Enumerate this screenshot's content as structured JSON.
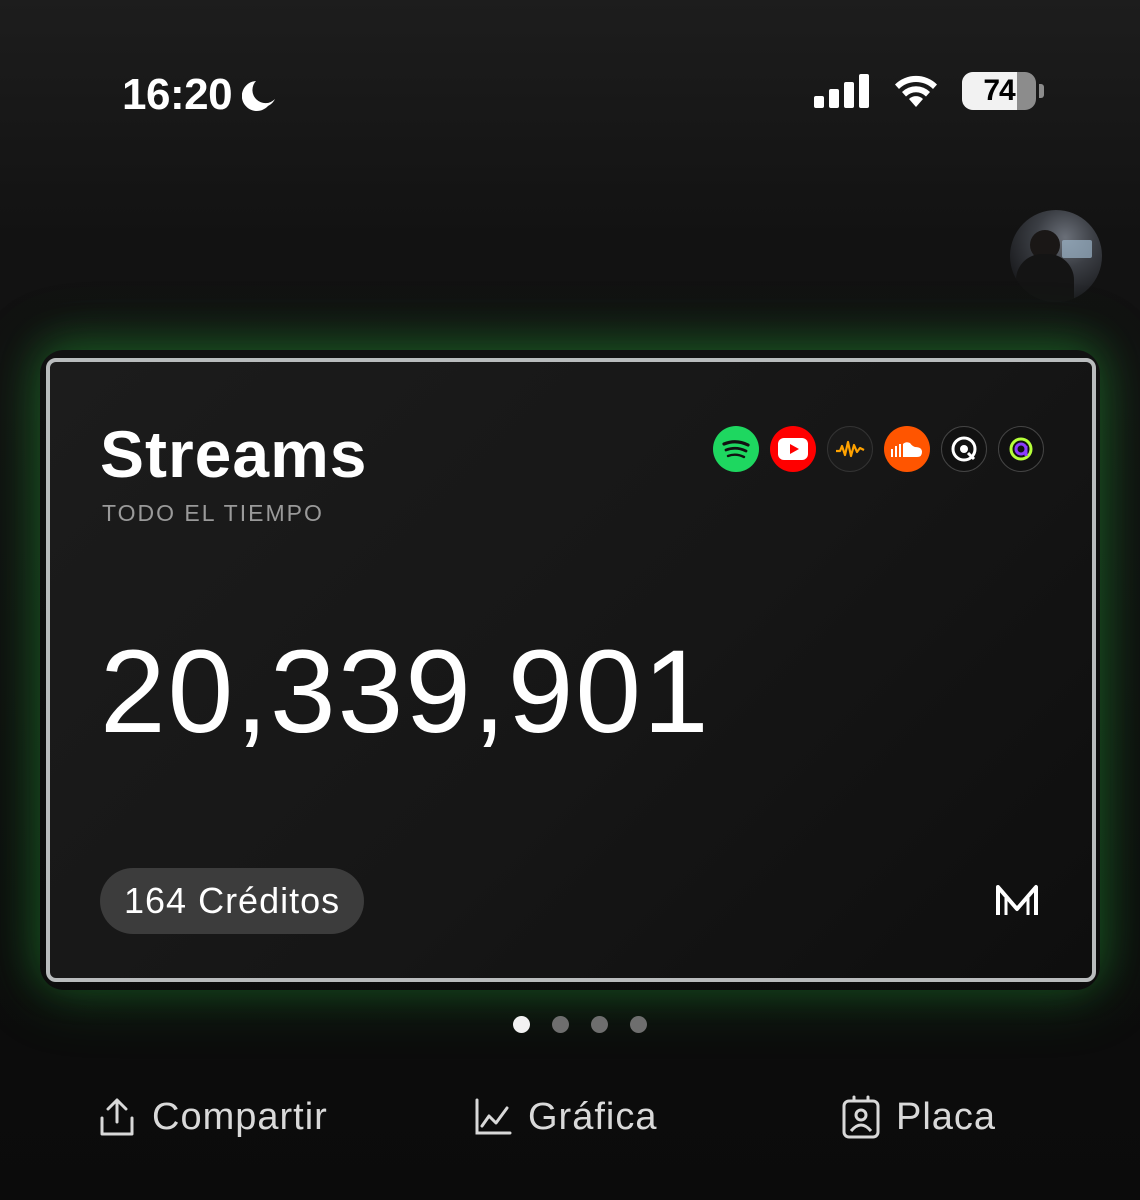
{
  "status_bar": {
    "time": "16:20",
    "battery_level": "74",
    "battery_fraction": 0.74
  },
  "card": {
    "title": "Streams",
    "subtitle": "TODO EL TIEMPO",
    "value": "20,339,901",
    "credits_label": "164 Créditos",
    "platforms": [
      "spotify-icon",
      "youtube-icon",
      "audiomack-icon",
      "soundcloud-icon",
      "qobuz-icon",
      "anghami-icon"
    ]
  },
  "pagination": {
    "total": 4,
    "active": 1
  },
  "actions": {
    "share_label": "Compartir",
    "chart_label": "Gráfica",
    "plaque_label": "Placa"
  },
  "colors": {
    "accent_glow": "#28aa3c",
    "spotify": "#1ed760",
    "youtube": "#ff0000",
    "soundcloud": "#ff5500",
    "audiomack": "#ffa200"
  }
}
